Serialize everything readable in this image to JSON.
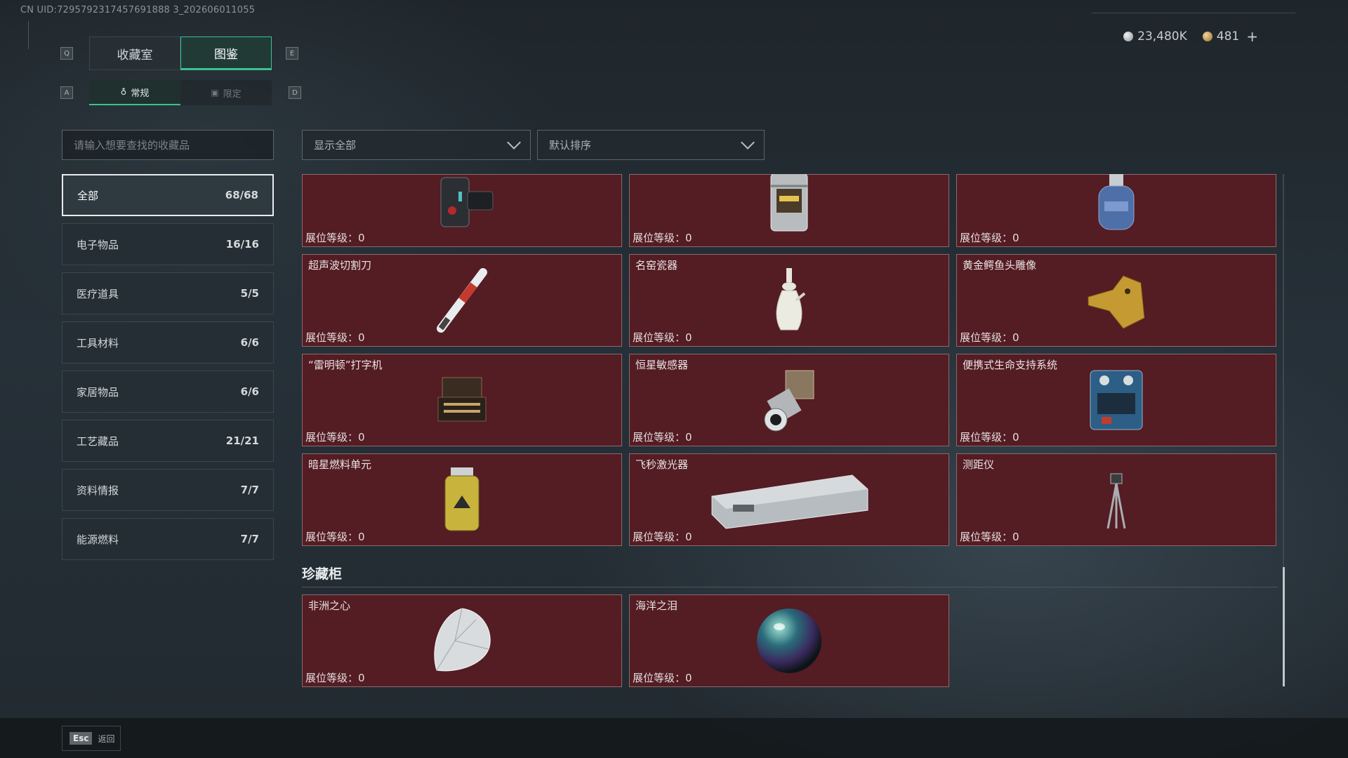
{
  "uid": "CN UID:7295792317457691888 3_202606011055",
  "currency": {
    "silver": "23,480K",
    "gold": "481",
    "plus": "+"
  },
  "keys": {
    "left_main": "Q",
    "right_main": "E",
    "left_sub": "A",
    "right_sub": "D"
  },
  "tabs": [
    {
      "label": "收藏室"
    },
    {
      "label": "图鉴"
    }
  ],
  "subtabs": [
    {
      "label": "常规"
    },
    {
      "label": "限定"
    }
  ],
  "search": {
    "placeholder": "请输入想要查找的收藏品"
  },
  "filters": {
    "show": "显示全部",
    "sort": "默认排序"
  },
  "categories": [
    {
      "label": "全部",
      "count": "68/68"
    },
    {
      "label": "电子物品",
      "count": "16/16"
    },
    {
      "label": "医疗道具",
      "count": "5/5"
    },
    {
      "label": "工具材料",
      "count": "6/6"
    },
    {
      "label": "家居物品",
      "count": "6/6"
    },
    {
      "label": "工艺藏品",
      "count": "21/21"
    },
    {
      "label": "资料情报",
      "count": "7/7"
    },
    {
      "label": "能源燃料",
      "count": "7/7"
    }
  ],
  "level_label": "展位等级：",
  "items_top": [
    {
      "name": "",
      "level": "0",
      "icon": "wrist-device-icon"
    },
    {
      "name": "",
      "level": "0",
      "icon": "lantern-icon"
    },
    {
      "name": "",
      "level": "0",
      "icon": "gas-canister-icon"
    }
  ],
  "items": [
    {
      "name": "超声波切割刀",
      "level": "0",
      "icon": "scalpel-icon"
    },
    {
      "name": "名窑瓷器",
      "level": "0",
      "icon": "porcelain-vase-icon"
    },
    {
      "name": "黄金鳄鱼头雕像",
      "level": "0",
      "icon": "golden-croc-icon"
    },
    {
      "name": "“雷明顿”打字机",
      "level": "0",
      "icon": "typewriter-icon"
    },
    {
      "name": "恒星敏感器",
      "level": "0",
      "icon": "star-sensor-icon"
    },
    {
      "name": "便携式生命支持系统",
      "level": "0",
      "icon": "life-support-icon"
    },
    {
      "name": "暗星燃料单元",
      "level": "0",
      "icon": "fuel-cell-icon"
    },
    {
      "name": "飞秒激光器",
      "level": "0",
      "icon": "laser-box-icon"
    },
    {
      "name": "测距仪",
      "level": "0",
      "icon": "tripod-icon"
    }
  ],
  "section": {
    "title": "珍藏柜"
  },
  "treasures": [
    {
      "name": "非洲之心",
      "level": "0",
      "icon": "diamond-icon"
    },
    {
      "name": "海洋之泪",
      "level": "0",
      "icon": "pearl-icon"
    }
  ],
  "bottom": {
    "esc": "Esc",
    "back": "返回"
  }
}
